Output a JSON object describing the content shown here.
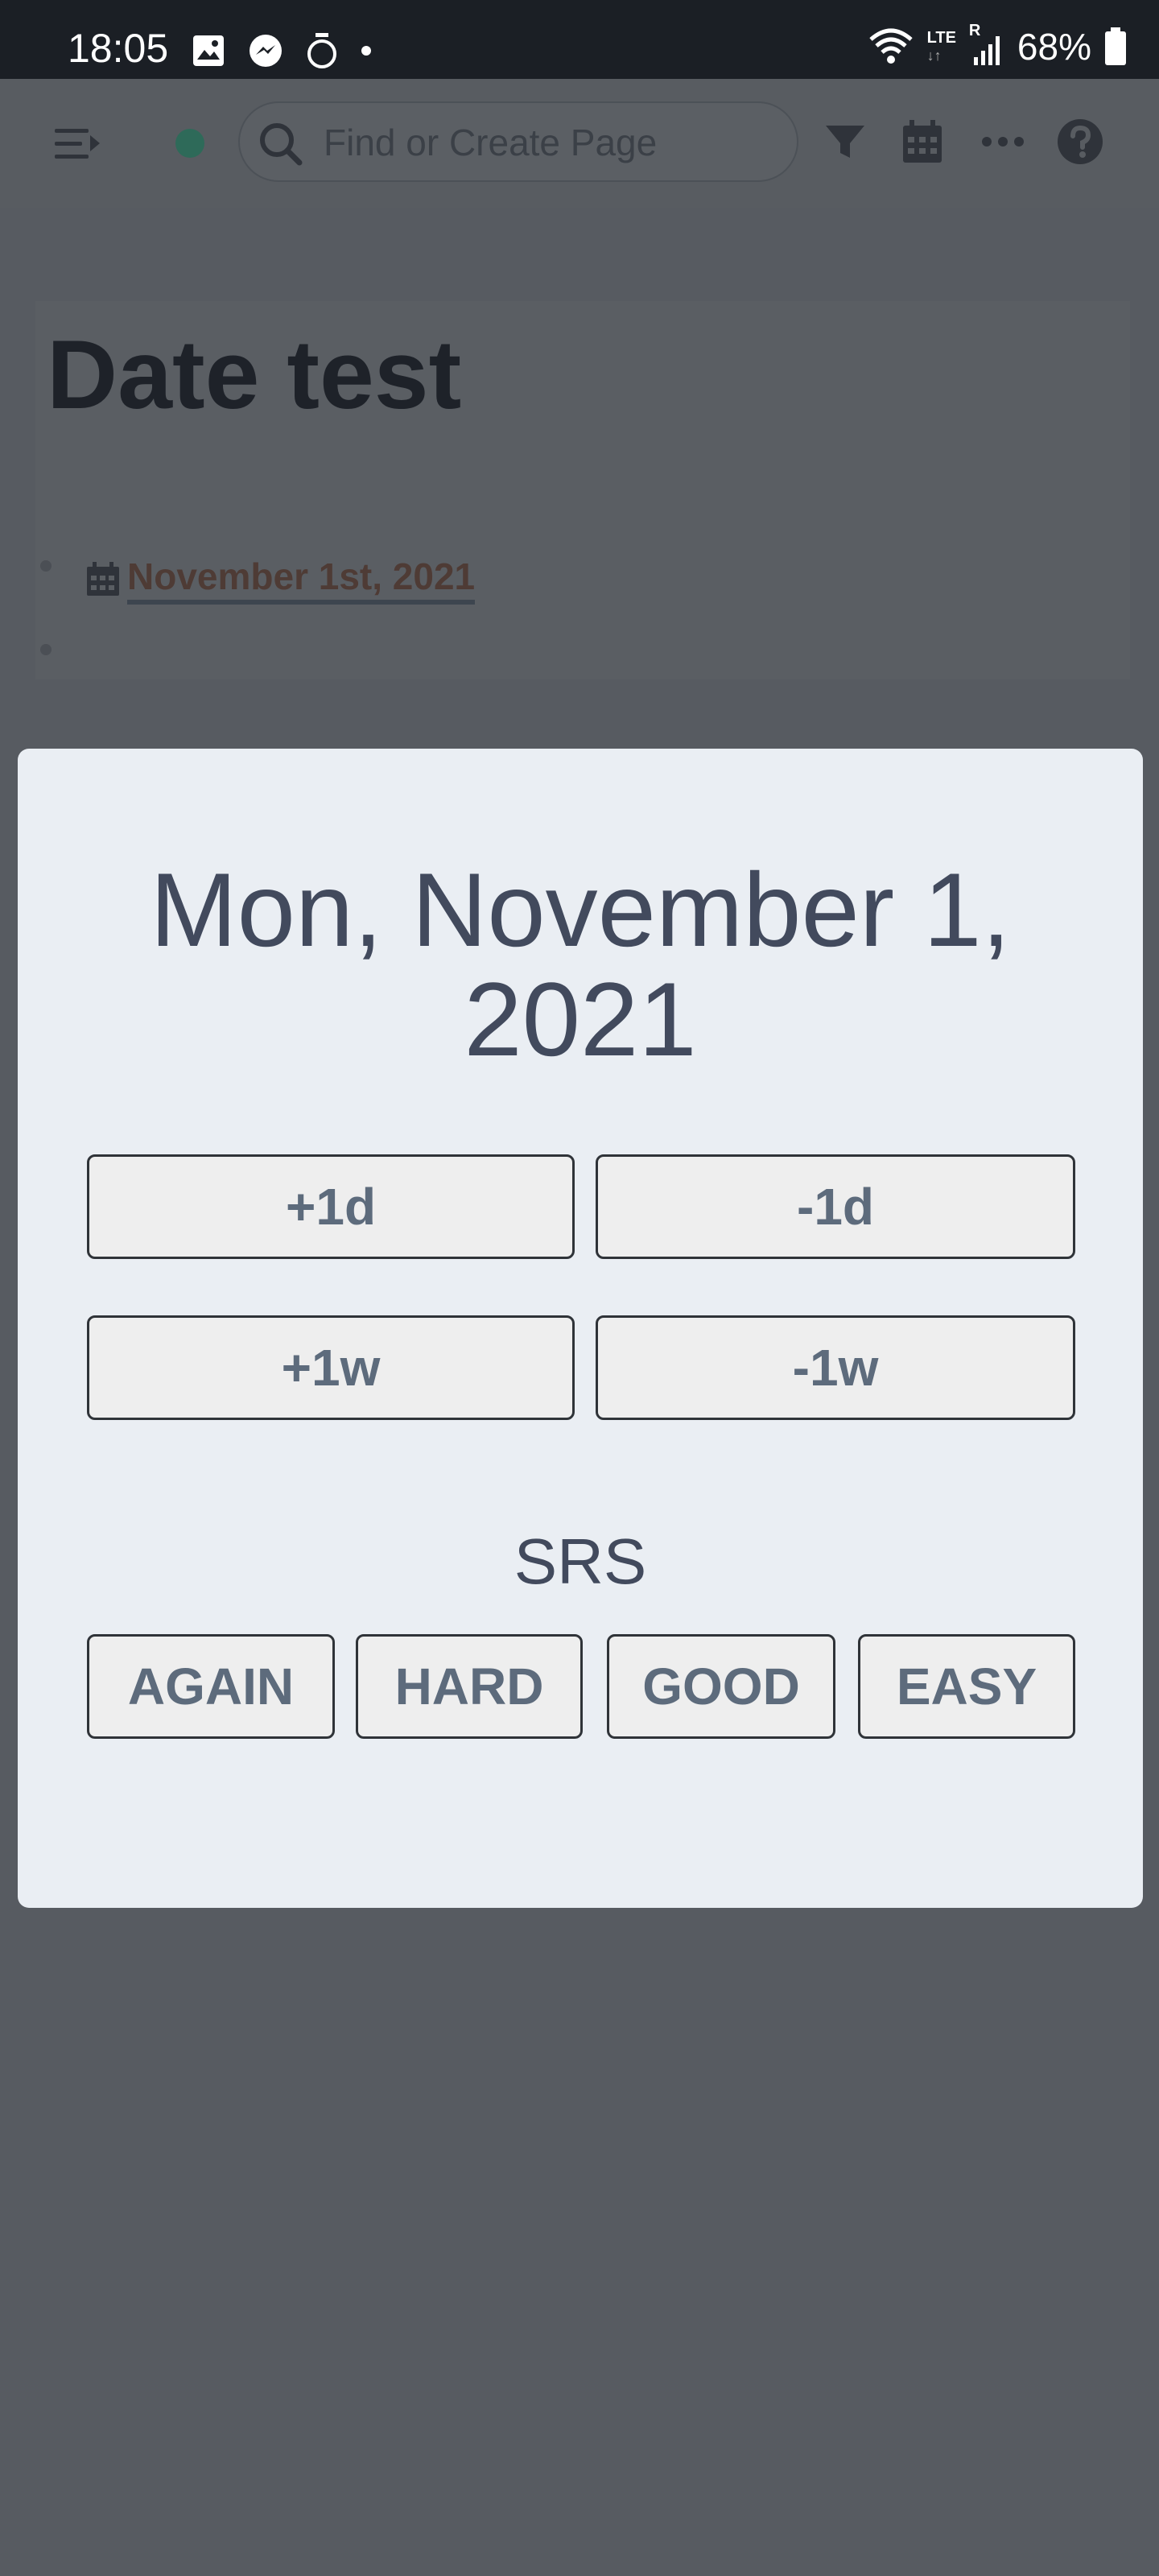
{
  "status_bar": {
    "time": "18:05",
    "network": "LTE",
    "roaming": "R",
    "battery": "68%"
  },
  "header": {
    "search_placeholder": "Find or Create Page"
  },
  "page": {
    "title": "Date test",
    "date_reference": "November 1st, 2021"
  },
  "date_picker": {
    "date_line1": "Mon, November 1,",
    "date_line2": "2021",
    "plus_day": "+1d",
    "minus_day": "-1d",
    "plus_week": "+1w",
    "minus_week": "-1w",
    "srs_label": "SRS",
    "srs_buttons": [
      "AGAIN",
      "HARD",
      "GOOD",
      "EASY"
    ]
  }
}
